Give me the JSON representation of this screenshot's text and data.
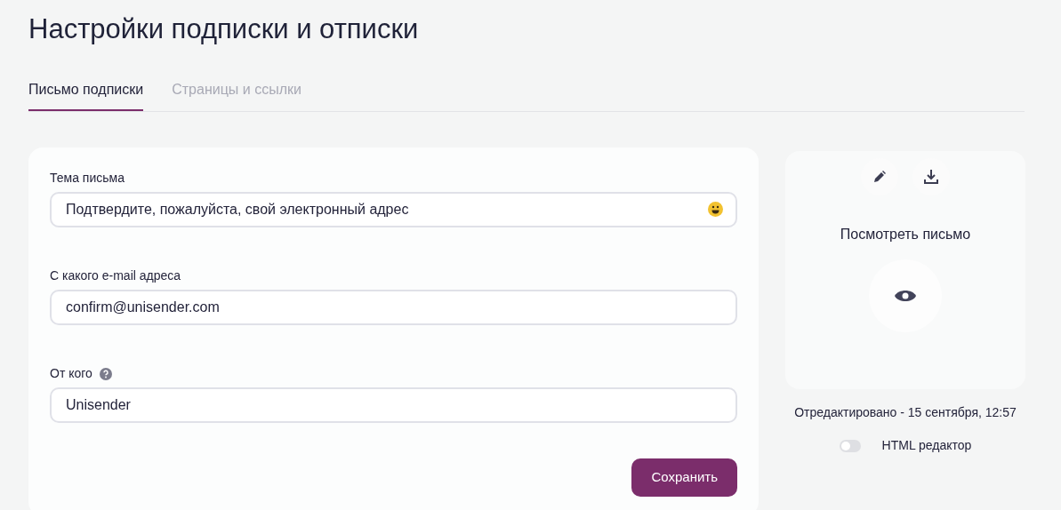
{
  "title": "Настройки подписки и отписки",
  "tabs": [
    {
      "label": "Письмо подписки",
      "selected": true
    },
    {
      "label": "Страницы и ссылки",
      "selected": false
    }
  ],
  "form": {
    "fields": [
      {
        "label": "Тема письма",
        "value": "Подтвердите, пожалуйста, свой электронный адрес",
        "help": false,
        "emoji": true
      },
      {
        "label": "С какого e-mail адреса",
        "value": "confirm@unisender.com",
        "help": false,
        "emoji": false
      },
      {
        "label": "От кого",
        "value": "Unisender",
        "help": true,
        "emoji": false
      }
    ],
    "save_button": "Сохранить"
  },
  "preview": {
    "title": "Посмотреть письмо",
    "edited": "Отредактировано - 15 сентября, 12:57",
    "html_editor": {
      "label": "HTML редактор",
      "on": false
    }
  }
}
